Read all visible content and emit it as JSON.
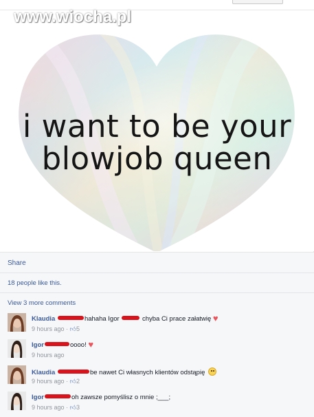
{
  "watermark": "www.wiocha.pl",
  "post": {
    "quote_line1": "i want to be your",
    "quote_line2": "blowjob queen"
  },
  "feedback": {
    "share_label": "Share",
    "likes_text": "18 people like this.",
    "more_comments": "View 3 more comments"
  },
  "comments": [
    {
      "author": "Klaudia",
      "text": "hahaha Igor",
      "text2": "chyba Ci prace załatwię",
      "time": "9 hours ago",
      "likes": "5",
      "emoji": "heart"
    },
    {
      "author": "Igor",
      "text": "oooo!",
      "time": "9 hours ago",
      "emoji": "heart"
    },
    {
      "author": "Klaudia",
      "text": "be nawet Ci własnych klientów odstąpię",
      "time": "9 hours ago",
      "likes": "2",
      "emoji": "smile"
    },
    {
      "author": "Igor",
      "text": "oh zawsze pomyślisz o mnie ;___;",
      "time": "9 hours ago",
      "likes": "3"
    }
  ],
  "icons": {
    "like": "thumbs-up-icon",
    "heart": "heart-emoji-icon",
    "smile": "smiley-emoji-icon"
  }
}
